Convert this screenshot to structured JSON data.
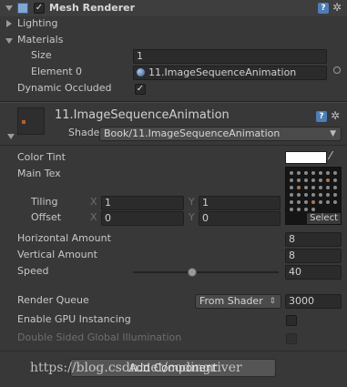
{
  "mesh_renderer": {
    "title": "Mesh Renderer",
    "enabled": true,
    "lighting_label": "Lighting",
    "materials_label": "Materials",
    "size_label": "Size",
    "size_value": "1",
    "element0_label": "Element 0",
    "element0_value": "11.ImageSequenceAnimation",
    "dynamic_occluded_label": "Dynamic Occluded",
    "dynamic_occluded": true
  },
  "material": {
    "name": "11.ImageSequenceAnimation",
    "shader_label": "Shader",
    "shader_value": "Book/11.ImageSequenceAnimation"
  },
  "properties": {
    "color_tint_label": "Color Tint",
    "color_tint_value": "#ffffff",
    "main_tex_label": "Main Tex",
    "tiling_label": "Tiling",
    "offset_label": "Offset",
    "x_label": "X",
    "y_label": "Y",
    "tiling_x": "1",
    "tiling_y": "1",
    "offset_x": "0",
    "offset_y": "0",
    "select_label": "Select",
    "horizontal_amount_label": "Horizontal Amount",
    "horizontal_amount": "8",
    "vertical_amount_label": "Vertical Amount",
    "vertical_amount": "8",
    "speed_label": "Speed",
    "speed_value": "40",
    "speed_fraction": 0.4,
    "render_queue_label": "Render Queue",
    "render_queue_mode": "From Shader",
    "render_queue_value": "3000",
    "gpu_instancing_label": "Enable GPU Instancing",
    "gpu_instancing": false,
    "double_sided_gi_label": "Double Sided Global Illumination",
    "double_sided_gi": false
  },
  "add_component_label": "Add Component",
  "watermark": "https://blog.csdn.net/codingriver",
  "colors": {
    "background": "#383838",
    "field": "#2b2b2b",
    "help_icon": "#4f7db8"
  }
}
